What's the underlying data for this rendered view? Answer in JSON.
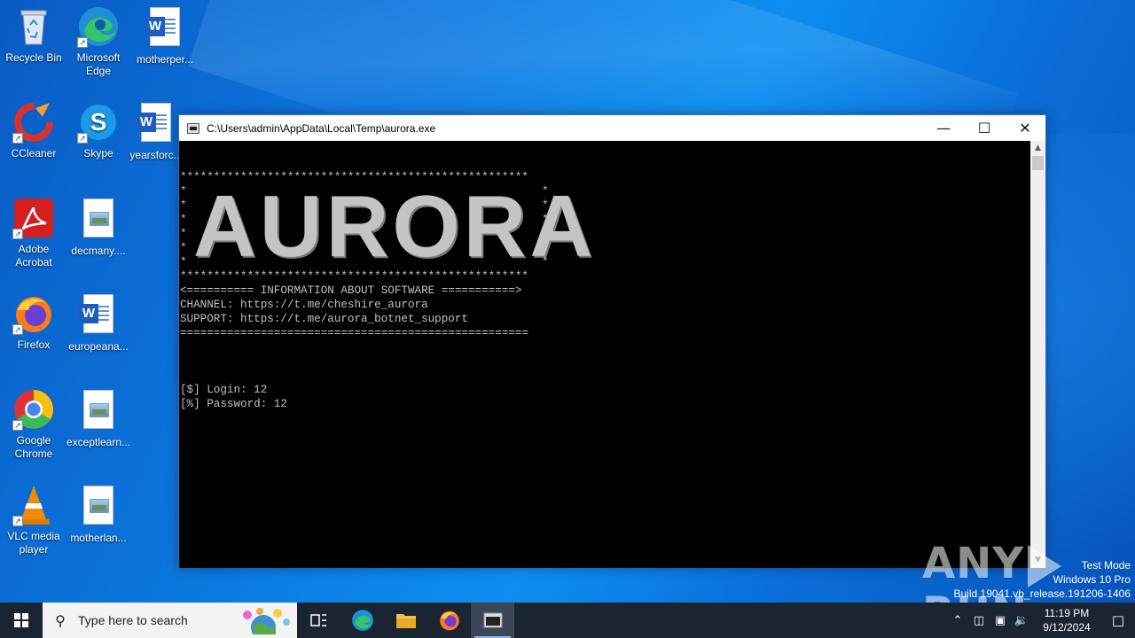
{
  "desktop": {
    "icons": [
      {
        "label": "Recycle Bin",
        "icon": "recycle-bin-icon"
      },
      {
        "label": "Microsoft Edge",
        "icon": "edge-icon"
      },
      {
        "label": "motherper...",
        "icon": "word-doc-icon"
      },
      {
        "label": "CCleaner",
        "icon": "ccleaner-icon"
      },
      {
        "label": "Skype",
        "icon": "skype-icon"
      },
      {
        "label": "yearsforc...",
        "icon": "word-doc-icon"
      },
      {
        "label": "Adobe Acrobat",
        "icon": "acrobat-icon"
      },
      {
        "label": "decmany....",
        "icon": "image-file-icon"
      },
      {
        "label": "Firefox",
        "icon": "firefox-icon"
      },
      {
        "label": "europeana...",
        "icon": "word-doc-icon"
      },
      {
        "label": "Google Chrome",
        "icon": "chrome-icon"
      },
      {
        "label": "exceptlearn...",
        "icon": "image-file-icon"
      },
      {
        "label": "VLC media player",
        "icon": "vlc-icon"
      },
      {
        "label": "motherlan...",
        "icon": "image-file-icon"
      }
    ]
  },
  "console": {
    "title": "C:\\Users\\admin\\AppData\\Local\\Temp\\aurora.exe",
    "banner_border": "****************************************************",
    "banner_word": [
      "A",
      "U",
      "R",
      "O",
      "R",
      "A"
    ],
    "info_header": "<========== INFORMATION ABOUT SOFTWARE ===========>",
    "channel": "CHANNEL: https://t.me/cheshire_aurora",
    "support": "SUPPORT: https://t.me/aurora_botnet_support",
    "separator": "====================================================",
    "login": "[$] Login: 12",
    "password": "[%] Password: 12"
  },
  "watermark": {
    "left": "ANY",
    "right": "RUN"
  },
  "system_info": {
    "line1": "Test Mode",
    "line2": "Windows 10 Pro",
    "line3": "Build 19041.vb_release.191206-1406"
  },
  "taskbar": {
    "search_placeholder": "Type here to search",
    "time": "11:19 PM",
    "date": "9/12/2024"
  },
  "colors": {
    "desktop_accent": "#0b7ae0",
    "taskbar": "#1b2431",
    "console_bg": "#000000",
    "console_text": "#c0c0c0"
  }
}
